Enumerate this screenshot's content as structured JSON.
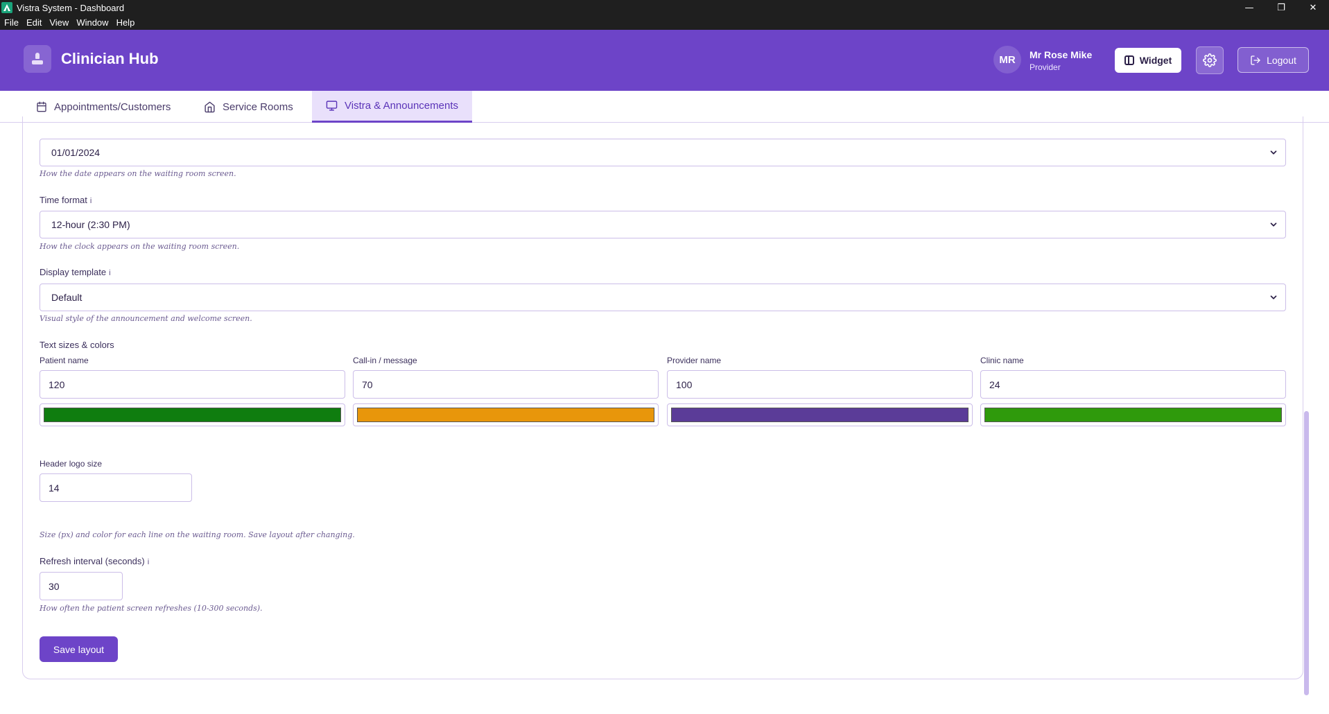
{
  "window": {
    "title": "Vistra System - Dashboard",
    "controls": {
      "minimize": "—",
      "maximize": "❐",
      "close": "✕"
    }
  },
  "menu": [
    "File",
    "Edit",
    "View",
    "Window",
    "Help"
  ],
  "header": {
    "brand": "Clinician Hub",
    "user": {
      "initials": "MR",
      "name": "Mr Rose Mike",
      "role": "Provider"
    },
    "widget_label": "Widget",
    "logout_label": "Logout"
  },
  "tabs": [
    {
      "label": "Appointments/Customers",
      "icon": "calendar-icon"
    },
    {
      "label": "Service Rooms",
      "icon": "home-icon"
    },
    {
      "label": "Vistra & Announcements",
      "icon": "monitor-icon",
      "active": true
    }
  ],
  "form": {
    "date_format": {
      "value": "01/01/2024",
      "hint": "How the date appears on the waiting room screen."
    },
    "time_format": {
      "label": "Time format",
      "info": "i",
      "value": "12-hour (2:30 PM)",
      "hint": "How the clock appears on the waiting room screen."
    },
    "display_template": {
      "label": "Display template",
      "info": "i",
      "value": "Default",
      "hint": "Visual style of the announcement and welcome screen."
    },
    "text_sizes": {
      "title": "Text sizes & colors",
      "fields": [
        {
          "label": "Patient name",
          "size": "120",
          "color": "#0f7d0f"
        },
        {
          "label": "Call-in / message",
          "size": "70",
          "color": "#e8960b"
        },
        {
          "label": "Provider name",
          "size": "100",
          "color": "#5b3c98"
        },
        {
          "label": "Clinic name",
          "size": "24",
          "color": "#2f9a0c"
        }
      ],
      "logo_label": "Header logo size",
      "logo_size": "14",
      "hint": "Size (px) and color for each line on the waiting room. Save layout after changing."
    },
    "refresh": {
      "label": "Refresh interval (seconds)",
      "info": "i",
      "value": "30",
      "hint": "How often the patient screen refreshes (10-300 seconds)."
    },
    "save_label": "Save layout"
  },
  "colors": {
    "accent": "#6d44c8",
    "tab_active_bg": "#e9e0fb"
  }
}
